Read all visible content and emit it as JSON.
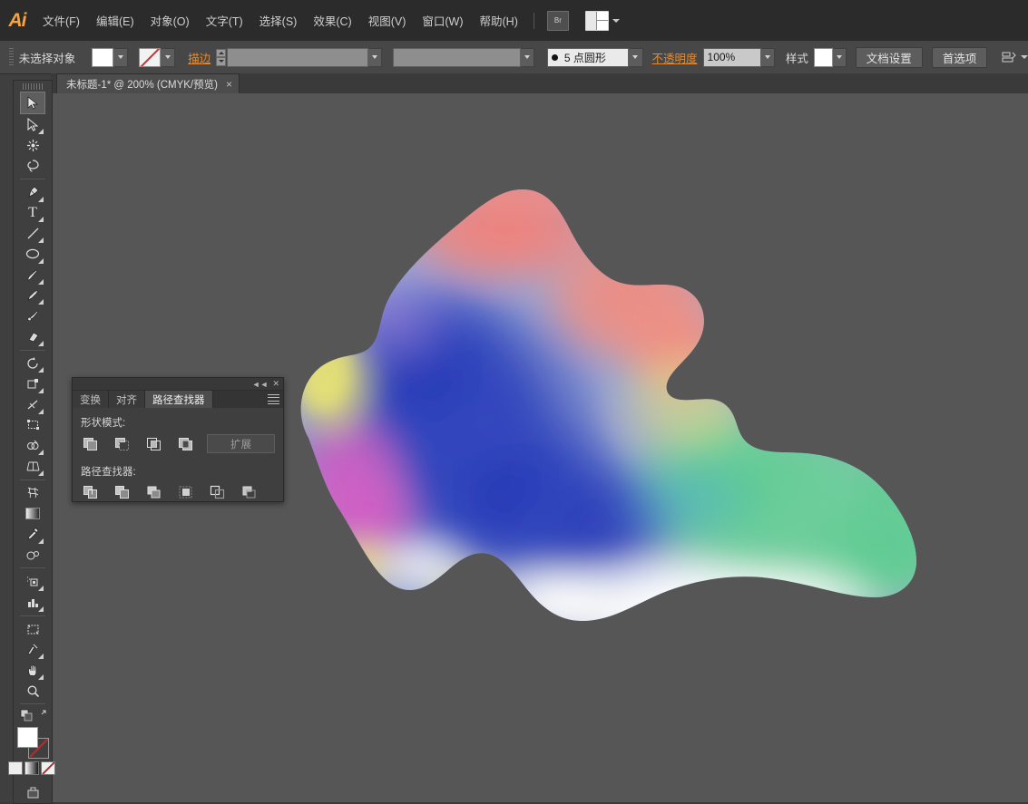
{
  "app": {
    "name": "Adobe Illustrator",
    "logo_text": "Ai"
  },
  "menubar": {
    "items": [
      {
        "label": "文件(F)",
        "name": "menu-file"
      },
      {
        "label": "编辑(E)",
        "name": "menu-edit"
      },
      {
        "label": "对象(O)",
        "name": "menu-object"
      },
      {
        "label": "文字(T)",
        "name": "menu-type"
      },
      {
        "label": "选择(S)",
        "name": "menu-select"
      },
      {
        "label": "效果(C)",
        "name": "menu-effect"
      },
      {
        "label": "视图(V)",
        "name": "menu-view"
      },
      {
        "label": "窗口(W)",
        "name": "menu-window"
      },
      {
        "label": "帮助(H)",
        "name": "menu-help"
      }
    ],
    "bridge_icon_label": "Br",
    "arrange_icon": "arrange-documents-icon"
  },
  "controlbar": {
    "selection_label": "未选择对象",
    "fill_label": "填色",
    "stroke_label": "描边",
    "stroke_weight_value": "",
    "brush_value": "5 点圆形",
    "opacity_label": "不透明度",
    "opacity_value": "100%",
    "style_label": "样式",
    "document_setup_label": "文档设置",
    "preferences_label": "首选项"
  },
  "document_tab": {
    "title": "未标题-1* @ 200% (CMYK/预览)",
    "close_glyph": "×"
  },
  "toolbar": {
    "tools": [
      {
        "name": "selection-tool",
        "active": true
      },
      {
        "name": "direct-selection-tool",
        "corner": true
      },
      {
        "name": "magic-wand-tool",
        "corner": false
      },
      {
        "name": "lasso-tool",
        "corner": false
      },
      {
        "name": "pen-tool",
        "corner": true
      },
      {
        "name": "type-tool",
        "corner": true
      },
      {
        "name": "line-segment-tool",
        "corner": true
      },
      {
        "name": "ellipse-tool",
        "corner": true
      },
      {
        "name": "paintbrush-tool",
        "corner": true
      },
      {
        "name": "pencil-tool",
        "corner": true
      },
      {
        "name": "blob-brush-tool",
        "corner": false
      },
      {
        "name": "eraser-tool",
        "corner": true
      },
      {
        "name": "rotate-tool",
        "corner": true
      },
      {
        "name": "scale-tool",
        "corner": true
      },
      {
        "name": "width-tool",
        "corner": true
      },
      {
        "name": "free-transform-tool",
        "corner": false
      },
      {
        "name": "shape-builder-tool",
        "corner": true
      },
      {
        "name": "perspective-grid-tool",
        "corner": true
      },
      {
        "name": "mesh-tool",
        "corner": false
      },
      {
        "name": "gradient-tool",
        "corner": false
      },
      {
        "name": "eyedropper-tool",
        "corner": true
      },
      {
        "name": "blend-tool",
        "corner": false
      },
      {
        "name": "symbol-sprayer-tool",
        "corner": true
      },
      {
        "name": "column-graph-tool",
        "corner": true
      },
      {
        "name": "artboard-tool",
        "corner": false
      },
      {
        "name": "slice-tool",
        "corner": true
      },
      {
        "name": "hand-tool",
        "corner": true
      },
      {
        "name": "zoom-tool",
        "corner": false
      }
    ],
    "fill_color": "#ffffff",
    "stroke_color": "none",
    "screen_mode_label": "更改屏幕模式"
  },
  "pathfinder_panel": {
    "tabs": [
      {
        "label": "变换",
        "selected": false,
        "name": "tab-transform"
      },
      {
        "label": "对齐",
        "selected": false,
        "name": "tab-align"
      },
      {
        "label": "路径查找器",
        "selected": true,
        "name": "tab-pathfinder"
      }
    ],
    "collapse_glyph": "◄◄",
    "close_glyph": "✕",
    "shape_modes_label": "形状模式:",
    "expand_label": "扩展",
    "pathfinders_label": "路径查找器:",
    "shape_mode_buttons": [
      {
        "name": "unite-button"
      },
      {
        "name": "minus-front-button"
      },
      {
        "name": "intersect-button"
      },
      {
        "name": "exclude-button"
      }
    ],
    "pathfinder_buttons": [
      {
        "name": "divide-button"
      },
      {
        "name": "trim-button"
      },
      {
        "name": "merge-button"
      },
      {
        "name": "crop-button"
      },
      {
        "name": "outline-button"
      },
      {
        "name": "minus-back-button"
      }
    ]
  },
  "canvas": {
    "artwork_name": "gradient-mesh-blob",
    "background_color": "#565656",
    "zoom": "200%",
    "color_mode": "CMYK/预览",
    "gradient_colors": {
      "blue_core": "#2c41b4",
      "coral_top": "#ef7f7f",
      "magenta_left": "#d757c2",
      "yellow_edge": "#e8e46a",
      "green_right": "#66cb96",
      "white_bottom": "#ffffff"
    }
  }
}
